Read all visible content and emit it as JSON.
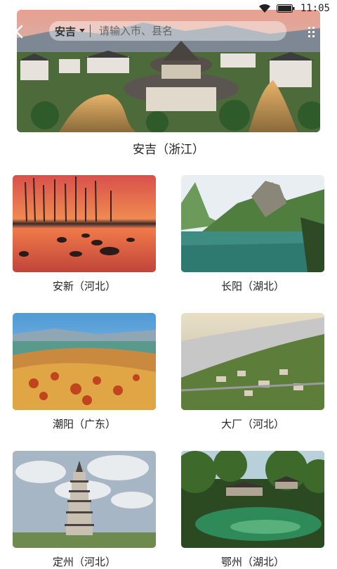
{
  "status_bar": {
    "time": "11:05",
    "icons": [
      "wifi-icon",
      "battery-icon"
    ]
  },
  "header": {
    "city": "安吉",
    "search_placeholder": "请输入市、县名",
    "icons": [
      "back-arrow-icon",
      "chevron-down-icon",
      "more-icon"
    ]
  },
  "featured": {
    "label": "安吉（浙江）"
  },
  "destinations": [
    {
      "label": "安新（河北）"
    },
    {
      "label": "长阳（湖北）"
    },
    {
      "label": "潮阳（广东）"
    },
    {
      "label": "大厂（河北）"
    },
    {
      "label": "定州（河北）"
    },
    {
      "label": "鄂州（湖北）"
    }
  ]
}
